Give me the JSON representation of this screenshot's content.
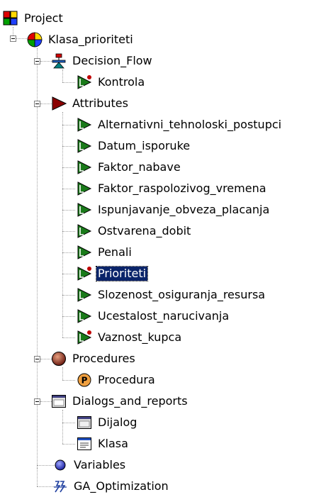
{
  "tree": {
    "root": {
      "label": "Project",
      "icon": "project-icon"
    },
    "class": {
      "label": "Klasa_prioriteti",
      "icon": "class-icon"
    },
    "decision_flow": {
      "label": "Decision_Flow",
      "icon": "decision-flow-icon",
      "children": [
        {
          "label": "Kontrola",
          "icon": "attribute-icon-dot"
        }
      ]
    },
    "attributes": {
      "label": "Attributes",
      "icon": "attributes-folder-icon",
      "children": [
        {
          "label": "Alternativni_tehnoloski_postupci"
        },
        {
          "label": "Datum_isporuke"
        },
        {
          "label": "Faktor_nabave"
        },
        {
          "label": "Faktor_raspolozivog_vremena"
        },
        {
          "label": "Ispunjavanje_obveza_placanja"
        },
        {
          "label": "Ostvarena_dobit"
        },
        {
          "label": "Penali"
        },
        {
          "label": "Prioriteti",
          "selected": true,
          "dot": true
        },
        {
          "label": "Slozenost_osiguranja_resursa"
        },
        {
          "label": "Ucestalost_narucivanja"
        },
        {
          "label": "Vaznost_kupca",
          "dot": true
        }
      ]
    },
    "procedures": {
      "label": "Procedures",
      "icon": "procedures-icon",
      "children": [
        {
          "label": "Procedura",
          "icon": "procedure-p-icon"
        }
      ]
    },
    "dialogs": {
      "label": "Dialogs_and_reports",
      "icon": "dialogs-icon",
      "children": [
        {
          "label": "Dijalog",
          "icon": "dialog-icon"
        },
        {
          "label": "Klasa",
          "icon": "report-icon"
        }
      ]
    },
    "variables": {
      "label": "Variables",
      "icon": "variables-icon"
    },
    "ga": {
      "label": "GA_Optimization",
      "icon": "ga-optimization-icon"
    }
  },
  "colors": {
    "selection": "#0a246a",
    "attribute_green": "#1a7a1a",
    "attributes_red": "#8b0000"
  }
}
